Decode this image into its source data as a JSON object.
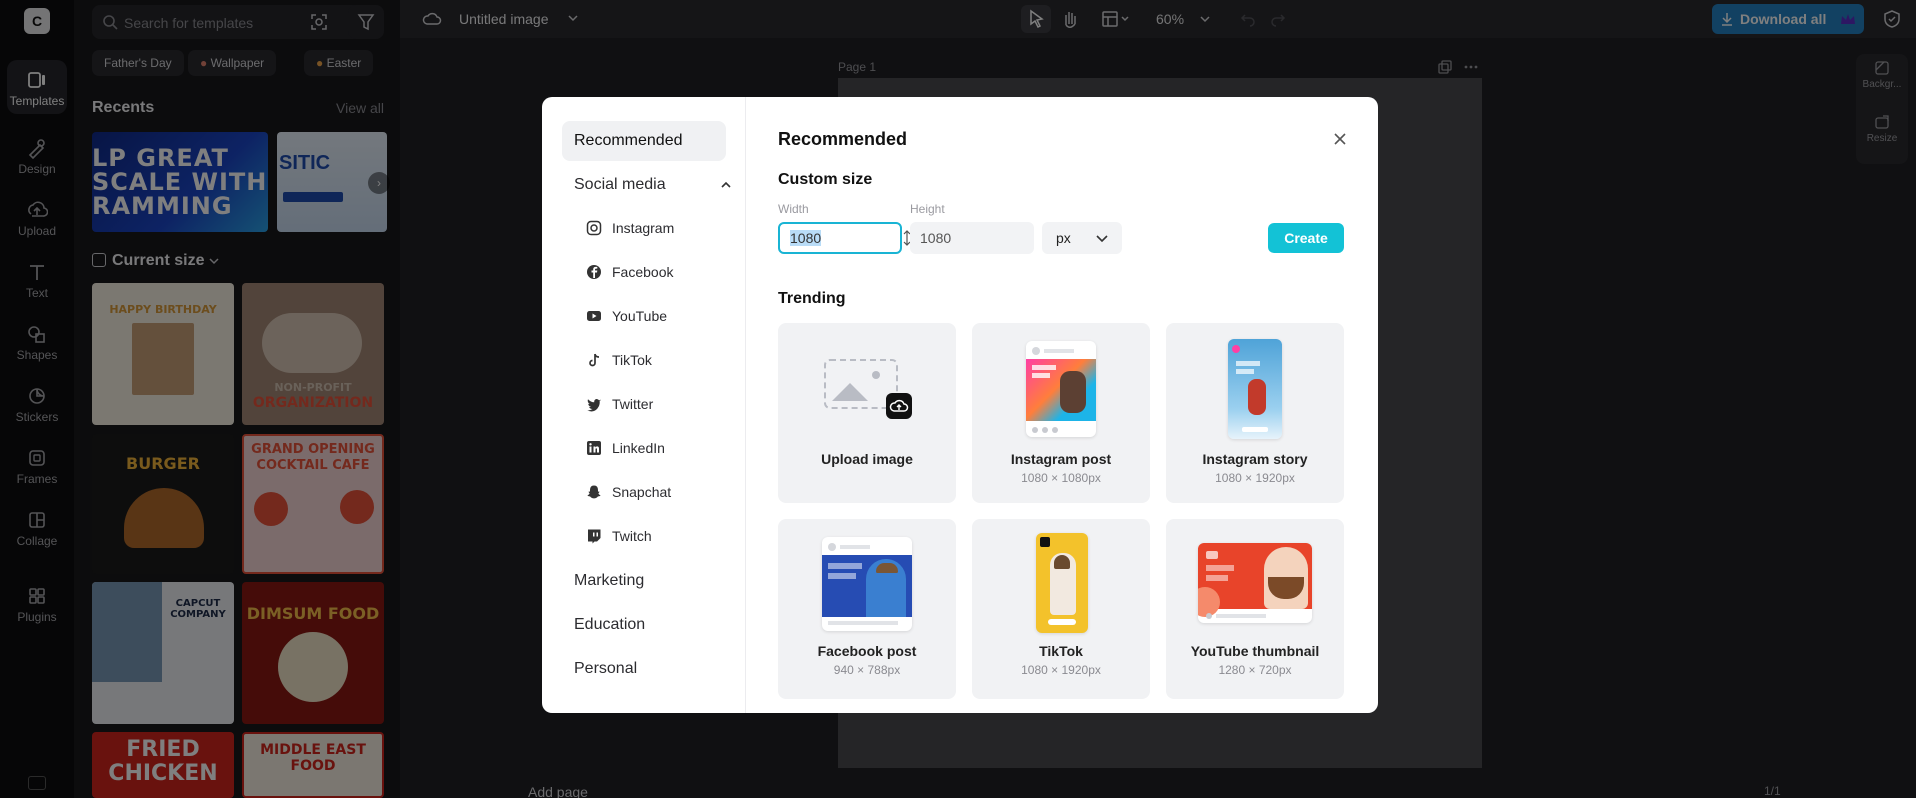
{
  "rail": {
    "logo": "C",
    "items": [
      {
        "label": "Templates",
        "icon": "templates-icon"
      },
      {
        "label": "Design",
        "icon": "design-icon"
      },
      {
        "label": "Upload",
        "icon": "upload-icon"
      },
      {
        "label": "Text",
        "icon": "text-icon"
      },
      {
        "label": "Shapes",
        "icon": "shapes-icon"
      },
      {
        "label": "Stickers",
        "icon": "stickers-icon"
      },
      {
        "label": "Frames",
        "icon": "frames-icon"
      },
      {
        "label": "Collage",
        "icon": "collage-icon"
      },
      {
        "label": "Plugins",
        "icon": "plugins-icon"
      }
    ]
  },
  "panel": {
    "search_placeholder": "Search for templates",
    "chips": [
      "Father's Day",
      "Wallpaper",
      "Easter"
    ],
    "recents_title": "Recents",
    "view_all": "View all",
    "current_size": "Current size",
    "recents": [
      {
        "text": "LP GREAT\nSCALE WITH\nRAMMING"
      },
      {
        "text": "SITIC"
      }
    ],
    "templates": [
      {
        "text": "HAPPY BIRTHDAY"
      },
      {
        "text": "ORGANIZATION",
        "text2": "NON-PROFIT"
      },
      {
        "text": "BURGER"
      },
      {
        "text": "GRAND OPENING COCKTAIL CAFE"
      },
      {
        "text": "CAPCUT COMPANY"
      },
      {
        "text": "DIMSUM FOOD"
      },
      {
        "text": "FRIED CHICKEN"
      },
      {
        "text": "MIDDLE EAST FOOD"
      }
    ]
  },
  "topbar": {
    "doc_title": "Untitled image",
    "zoom": "60%",
    "download_label": "Download all"
  },
  "canvas": {
    "page_label": "Page 1",
    "add_page": "Add page",
    "page_count": "1/1",
    "right_tools": [
      "Backgr...",
      "Resize"
    ]
  },
  "modal": {
    "title": "Recommended",
    "sidebar": {
      "recommended": "Recommended",
      "social_media": "Social media",
      "social_items": [
        "Instagram",
        "Facebook",
        "YouTube",
        "TikTok",
        "Twitter",
        "LinkedIn",
        "Snapchat",
        "Twitch"
      ],
      "marketing": "Marketing",
      "education": "Education",
      "personal": "Personal"
    },
    "custom_size": {
      "title": "Custom size",
      "width_label": "Width",
      "height_label": "Height",
      "width_value": "1080",
      "height_value": "1080",
      "unit": "px",
      "create_label": "Create"
    },
    "trending_title": "Trending",
    "cards": [
      {
        "name": "Upload image",
        "dim": ""
      },
      {
        "name": "Instagram post",
        "dim": "1080 × 1080px"
      },
      {
        "name": "Instagram story",
        "dim": "1080 × 1920px"
      },
      {
        "name": "Facebook post",
        "dim": "940 × 788px"
      },
      {
        "name": "TikTok",
        "dim": "1080 × 1920px"
      },
      {
        "name": "YouTube thumbnail",
        "dim": "1280 × 720px"
      }
    ]
  },
  "colors": {
    "accent": "#13c2d6",
    "focus_border": "#19b4d4",
    "download": "#2583c4"
  }
}
